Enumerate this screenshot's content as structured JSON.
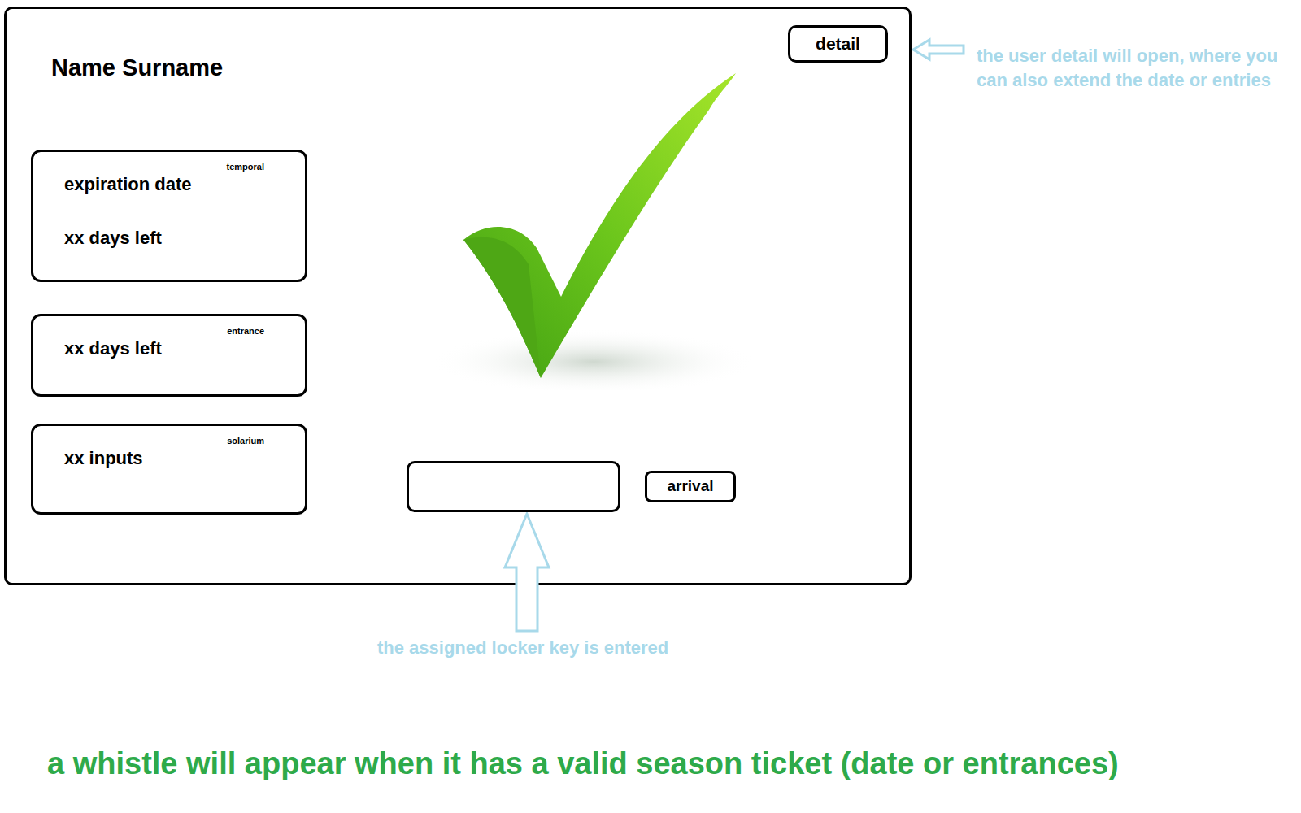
{
  "user": {
    "name": "Name Surname"
  },
  "detail_button": "detail",
  "cards": [
    {
      "tag": "temporal",
      "lines": [
        "expiration date",
        "xx days left"
      ]
    },
    {
      "tag": "entrance",
      "lines": [
        "xx days left"
      ]
    },
    {
      "tag": "solarium",
      "lines": [
        "xx inputs"
      ]
    }
  ],
  "status": {
    "valid": true
  },
  "locker_input": {
    "value": ""
  },
  "arrival_button": "arrival",
  "annotations": {
    "detail": "the user detail will open, where you can also extend the date or entries",
    "locker": "the assigned locker key is entered",
    "footer": "a whistle will appear when it has a valid season ticket (date or entrances)"
  }
}
